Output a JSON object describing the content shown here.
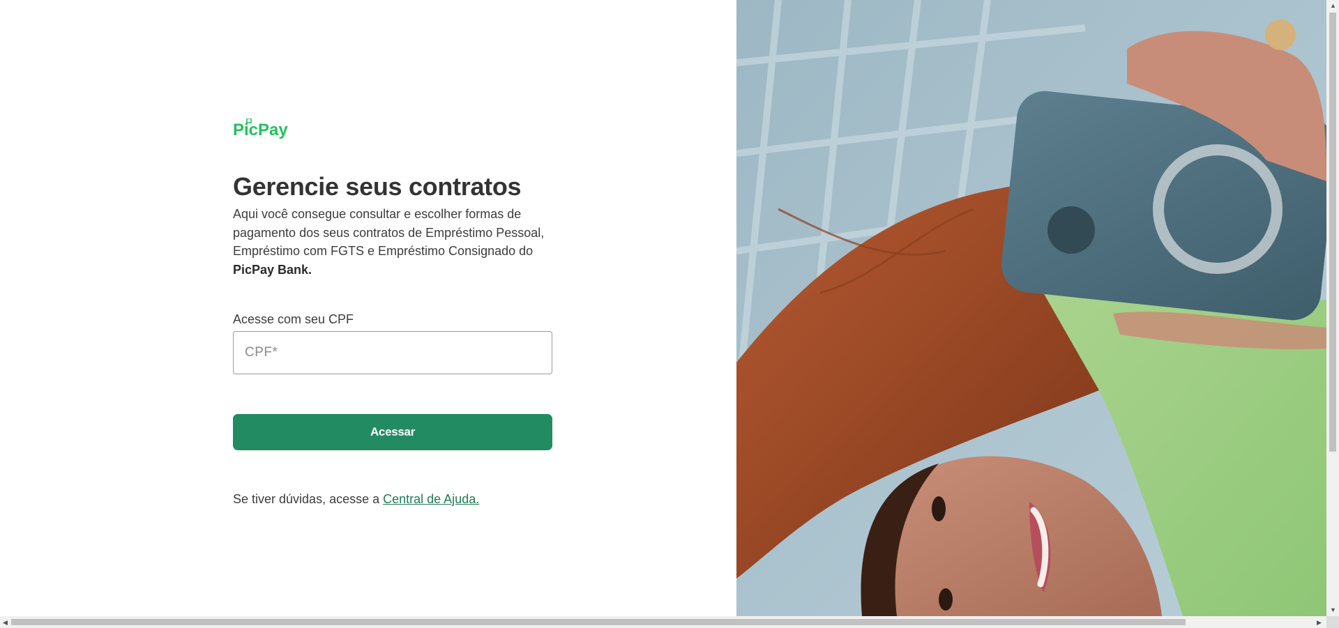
{
  "brand": {
    "logo_text": "PicPay",
    "logo_color": "#21c25e"
  },
  "main": {
    "title": "Gerencie seus contratos",
    "description_text": "Aqui você consegue consultar e escolher formas de pagamento dos seus contratos de Empréstimo Pessoal, Empréstimo com FGTS e Empréstimo Consignado do ",
    "description_bold": "PicPay Bank.",
    "field_label": "Acesse com seu CPF",
    "cpf_placeholder": "CPF*",
    "cpf_value": "",
    "submit_label": "Acessar",
    "help_text": "Se tiver dúvidas, acesse a ",
    "help_link": "Central de Ajuda."
  },
  "colors": {
    "accent": "#238b62",
    "link": "#1f7a55",
    "text": "#3c3c3c"
  },
  "icons": {
    "scroll_up": "▲",
    "scroll_down": "▼",
    "scroll_left": "◀",
    "scroll_right": "▶"
  }
}
